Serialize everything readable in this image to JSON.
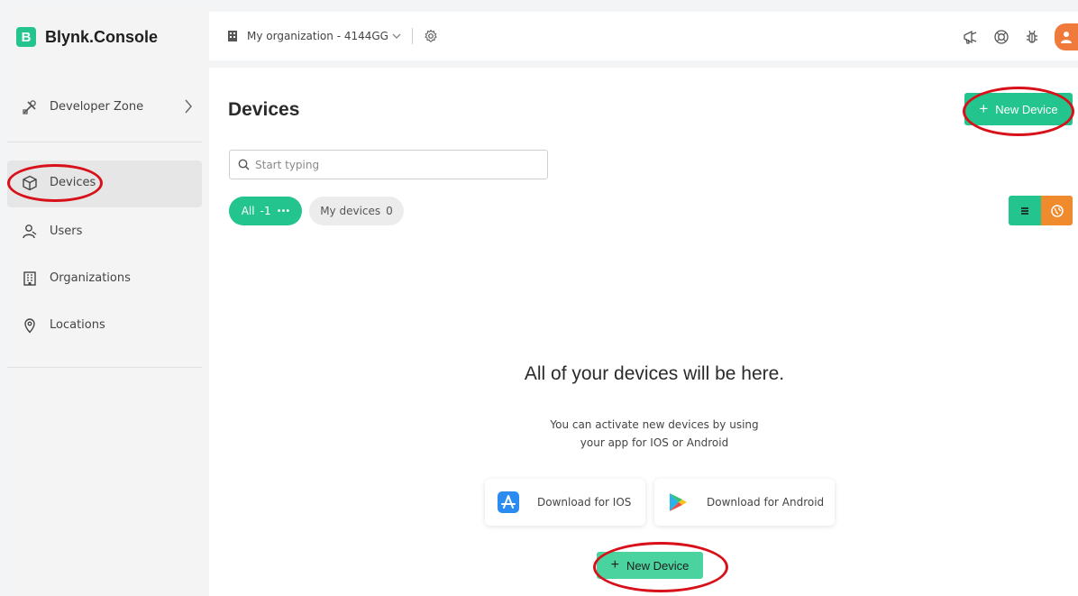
{
  "app": {
    "brand_letter": "B",
    "brand_name": "Blynk.Console"
  },
  "sidebar": {
    "developer_zone": {
      "label": "Developer Zone",
      "icon": "tools-icon"
    },
    "items": [
      {
        "label": "Devices",
        "icon": "cube-icon",
        "active": true
      },
      {
        "label": "Users",
        "icon": "users-icon"
      },
      {
        "label": "Organizations",
        "icon": "building-icon"
      },
      {
        "label": "Locations",
        "icon": "location-pin-icon"
      }
    ]
  },
  "topbar": {
    "organization": "My organization - 4144GG",
    "icons": [
      "announcement-icon",
      "help-lifebuoy-icon",
      "bug-icon",
      "user-avatar"
    ]
  },
  "main": {
    "title": "Devices",
    "new_device_label": "New Device",
    "search_placeholder": "Start typing",
    "filters": {
      "all": {
        "label": "All",
        "count": "-1"
      },
      "my": {
        "label": "My devices",
        "count": "0"
      }
    },
    "empty": {
      "title": "All of your devices will be here.",
      "line1": "You can activate new devices by using",
      "line2": "your app for IOS or Android"
    },
    "downloads": {
      "ios": "Download for IOS",
      "android": "Download for Android"
    },
    "bottom_button_label": "New Device"
  },
  "colors": {
    "accent_green": "#23c48e",
    "accent_orange": "#ef8a2d",
    "annotation_red": "#d8101a"
  }
}
